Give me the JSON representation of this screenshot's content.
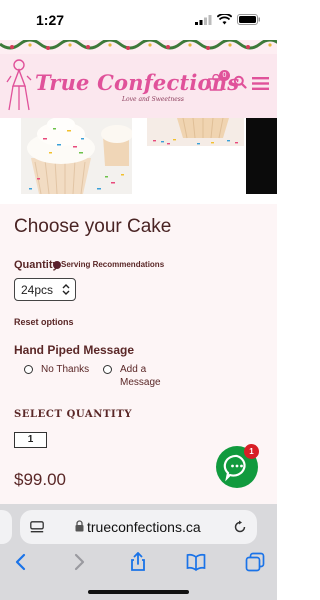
{
  "status_bar": {
    "time": "1:27"
  },
  "header": {
    "brand": "True Confections",
    "tagline": "Love and Sweetness",
    "cart_count": "0",
    "colors": {
      "brand_pink": "#e0529a",
      "header_bg": "#fbe7ee"
    },
    "icons": [
      "cart-icon",
      "search-icon",
      "hamburger-menu-icon"
    ]
  },
  "product": {
    "title": "Choose your Cake",
    "quantity_label": "Quantity",
    "serving_link": "Serving Recommendations",
    "size_value": "24pcs",
    "reset_label": "Reset options",
    "message_heading": "Hand Piped Message",
    "message_options": [
      "No Thanks",
      "Add a Message"
    ],
    "select_quantity_label": "SELECT QUANTITY",
    "quantity_value": "1",
    "price": "$99.00"
  },
  "chat": {
    "badge": "1",
    "color": "#119a3e"
  },
  "browser": {
    "url": "trueconfections.ca",
    "nav_icons": [
      "back-icon",
      "forward-icon",
      "share-icon",
      "bookmarks-icon",
      "tabs-icon"
    ]
  }
}
